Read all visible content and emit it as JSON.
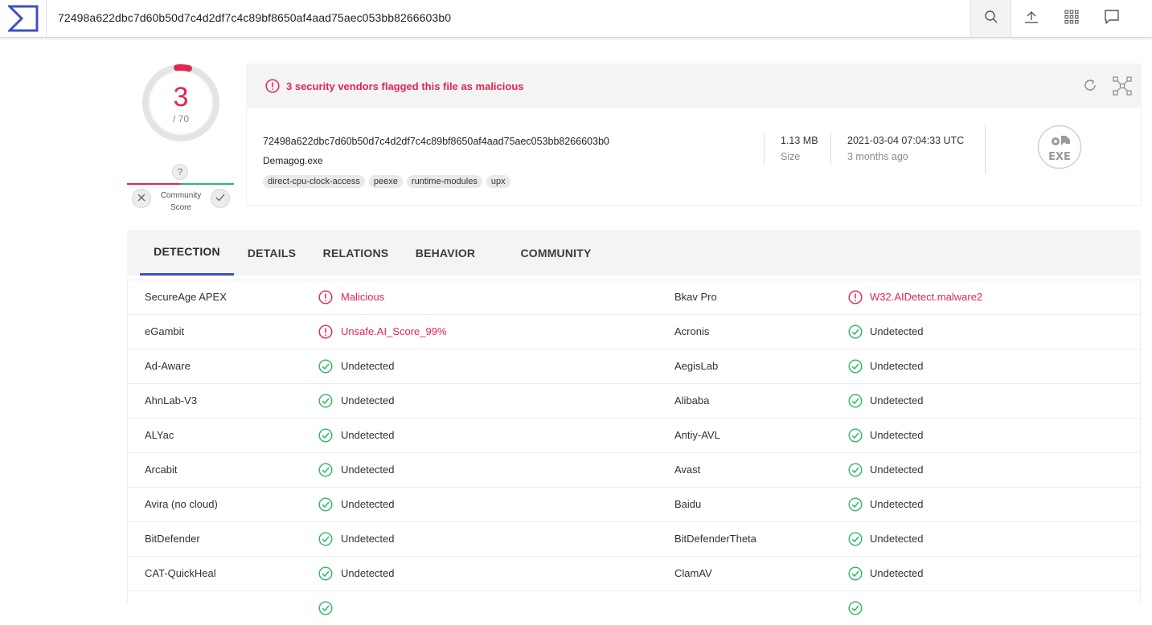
{
  "search": {
    "query": "72498a622dbc7d60b50d7c4d2df7c4c89bf8650af4aad75aec053bb8266603b0"
  },
  "icons": {
    "logo": "virustotal-sigma-icon",
    "search": "search-icon",
    "upload": "upload-icon",
    "apps": "grid-icon",
    "comment": "comment-icon"
  },
  "score": {
    "detected": "3",
    "total": "/ 70",
    "community_unknown": "?",
    "community_label_1": "Community",
    "community_label_2": "Score"
  },
  "banner": {
    "text": "3 security vendors flagged this file as malicious"
  },
  "file": {
    "hash": "72498a622dbc7d60b50d7c4d2df7c4c89bf8650af4aad75aec053bb8266603b0",
    "name": "Demagog.exe",
    "tags": [
      "direct-cpu-clock-access",
      "peexe",
      "runtime-modules",
      "upx"
    ],
    "size_value": "1.13 MB",
    "size_label": "Size",
    "date_value": "2021-03-04 07:04:33 UTC",
    "date_label": "3 months ago",
    "type_label": "EXE"
  },
  "tabs": [
    "DETECTION",
    "DETAILS",
    "RELATIONS",
    "BEHAVIOR",
    "COMMUNITY"
  ],
  "colors": {
    "malicious": "#e1264f",
    "clean": "#2db866",
    "accent": "#3c50c8"
  },
  "detections": [
    {
      "left_engine": "SecureAge APEX",
      "left_result": "Malicious",
      "left_status": "malicious",
      "right_engine": "Bkav Pro",
      "right_result": "W32.AIDetect.malware2",
      "right_status": "malicious"
    },
    {
      "left_engine": "eGambit",
      "left_result": "Unsafe.AI_Score_99%",
      "left_status": "malicious",
      "right_engine": "Acronis",
      "right_result": "Undetected",
      "right_status": "clean"
    },
    {
      "left_engine": "Ad-Aware",
      "left_result": "Undetected",
      "left_status": "clean",
      "right_engine": "AegisLab",
      "right_result": "Undetected",
      "right_status": "clean"
    },
    {
      "left_engine": "AhnLab-V3",
      "left_result": "Undetected",
      "left_status": "clean",
      "right_engine": "Alibaba",
      "right_result": "Undetected",
      "right_status": "clean"
    },
    {
      "left_engine": "ALYac",
      "left_result": "Undetected",
      "left_status": "clean",
      "right_engine": "Antiy-AVL",
      "right_result": "Undetected",
      "right_status": "clean"
    },
    {
      "left_engine": "Arcabit",
      "left_result": "Undetected",
      "left_status": "clean",
      "right_engine": "Avast",
      "right_result": "Undetected",
      "right_status": "clean"
    },
    {
      "left_engine": "Avira (no cloud)",
      "left_result": "Undetected",
      "left_status": "clean",
      "right_engine": "Baidu",
      "right_result": "Undetected",
      "right_status": "clean"
    },
    {
      "left_engine": "BitDefender",
      "left_result": "Undetected",
      "left_status": "clean",
      "right_engine": "BitDefenderTheta",
      "right_result": "Undetected",
      "right_status": "clean"
    },
    {
      "left_engine": "CAT-QuickHeal",
      "left_result": "Undetected",
      "left_status": "clean",
      "right_engine": "ClamAV",
      "right_result": "Undetected",
      "right_status": "clean"
    },
    {
      "left_engine": "",
      "left_result": "",
      "left_status": "clean",
      "right_engine": "",
      "right_result": "",
      "right_status": "clean"
    }
  ]
}
